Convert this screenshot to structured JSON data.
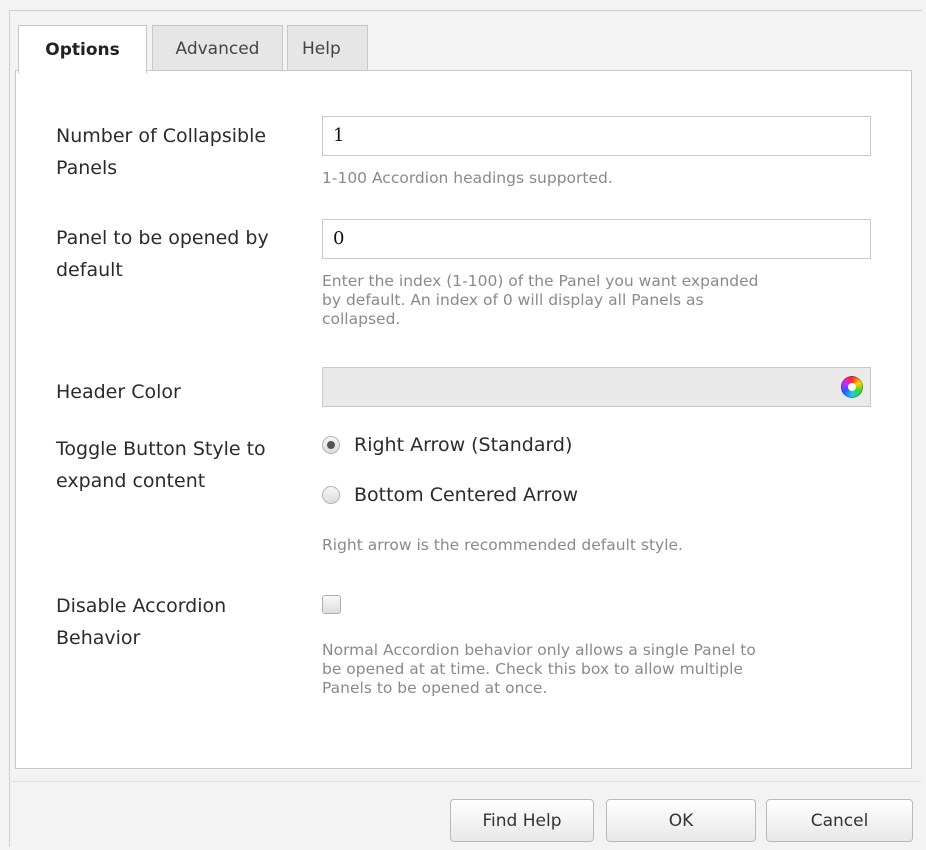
{
  "tabs": [
    {
      "label": "Options",
      "active": true
    },
    {
      "label": "Advanced",
      "active": false
    },
    {
      "label": "Help",
      "active": false
    }
  ],
  "fields": {
    "num_panels": {
      "label_line1": "Number of Collapsible",
      "label_line2": "Panels",
      "value": "1",
      "help": "1-100 Accordion headings supported."
    },
    "default_panel": {
      "label_line1": "Panel to be opened by",
      "label_line2": "default",
      "value": "0",
      "help_line1": "Enter the index (1-100) of the Panel you want expanded",
      "help_line2": "by default. An index of 0 will display all Panels as",
      "help_line3": "collapsed."
    },
    "header_color": {
      "label": "Header Color",
      "value": "",
      "icon": "color-wheel-icon"
    },
    "toggle_style": {
      "label_line1": "Toggle Button Style to",
      "label_line2": "expand content",
      "options": [
        {
          "label": "Right Arrow (Standard)",
          "checked": true
        },
        {
          "label": "Bottom Centered Arrow",
          "checked": false
        }
      ],
      "help": "Right arrow is the recommended default style."
    },
    "disable_accordion": {
      "label_line1": "Disable Accordion",
      "label_line2": "Behavior",
      "checked": false,
      "help_line1": "Normal Accordion behavior only allows a single Panel to",
      "help_line2": "be opened at at time. Check this box to allow multiple",
      "help_line3": "Panels to be opened at once."
    }
  },
  "buttons": {
    "find_help": "Find Help",
    "ok": "OK",
    "cancel": "Cancel"
  }
}
